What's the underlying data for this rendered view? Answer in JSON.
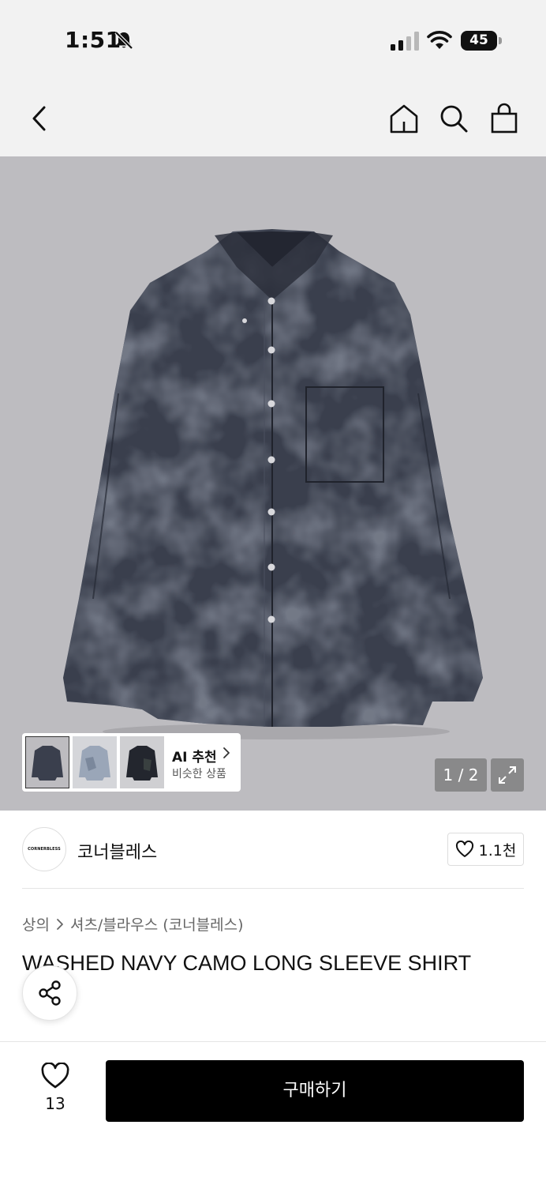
{
  "status_bar": {
    "time": "1:51",
    "battery": "45"
  },
  "nav": {
    "icons": [
      "back-icon",
      "home-icon",
      "search-icon",
      "shopping-bag-icon"
    ]
  },
  "gallery": {
    "page_counter": "1 / 2",
    "ai": {
      "title": "AI 추천",
      "subtitle": "비슷한 상품"
    }
  },
  "brand": {
    "name": "코너블레스",
    "logo_text": "CORNERBLESS",
    "likes": "1.1천"
  },
  "breadcrumb": {
    "level1": "상의",
    "level2": "셔츠/블라우스 (코너블레스)"
  },
  "product": {
    "title": "WASHED NAVY CAMO LONG SLEEVE SHIRT"
  },
  "bottom": {
    "wish_count": "13",
    "buy_label": "구매하기"
  },
  "colors": {
    "hero_bg": "#bdbcc0",
    "buy_button": "#000000",
    "shirt": "#2f3340"
  }
}
